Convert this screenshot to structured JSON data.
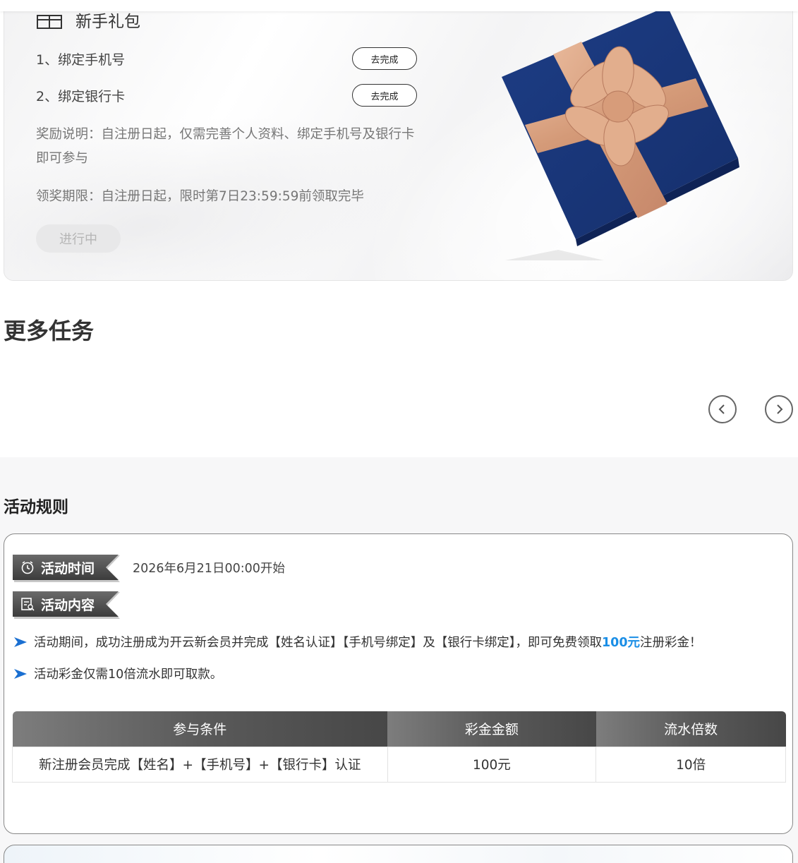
{
  "gift": {
    "title": "新手礼包",
    "tasks": [
      {
        "label": "1、绑定手机号",
        "button": "去完成"
      },
      {
        "label": "2、绑定银行卡",
        "button": "去完成"
      }
    ],
    "reward_desc": "奖励说明：自注册日起，仅需完善个人资料、绑定手机号及银行卡即可参与",
    "deadline": "领奖期限：自注册日起，限时第7日23:59:59前领取完毕",
    "status_button": "进行中"
  },
  "more_tasks": {
    "title": "更多任务",
    "prev_icon": "chevron-left-icon",
    "next_icon": "chevron-right-icon"
  },
  "rules": {
    "title": "活动规则",
    "time_tag": "活动时间",
    "time_value": "2026年6月21日00:00开始",
    "content_tag": "活动内容",
    "line1_pre": "活动期间，成功注册成为开云新会员并完成【姓名认证】【手机号绑定】及【银行卡绑定】，即可免费领取",
    "line1_highlight": "100元",
    "line1_post": "注册彩金！",
    "line2": "活动彩金仅需10倍流水即可取款。",
    "table": {
      "headers": [
        "参与条件",
        "彩金金额",
        "流水倍数"
      ],
      "rows": [
        [
          "新注册会员完成【姓名】+【手机号】+【银行卡】认证",
          "100元",
          "10倍"
        ]
      ]
    },
    "colors": {
      "highlight": "#1a8ee6",
      "tag_dark": "#3c3c3c"
    }
  }
}
